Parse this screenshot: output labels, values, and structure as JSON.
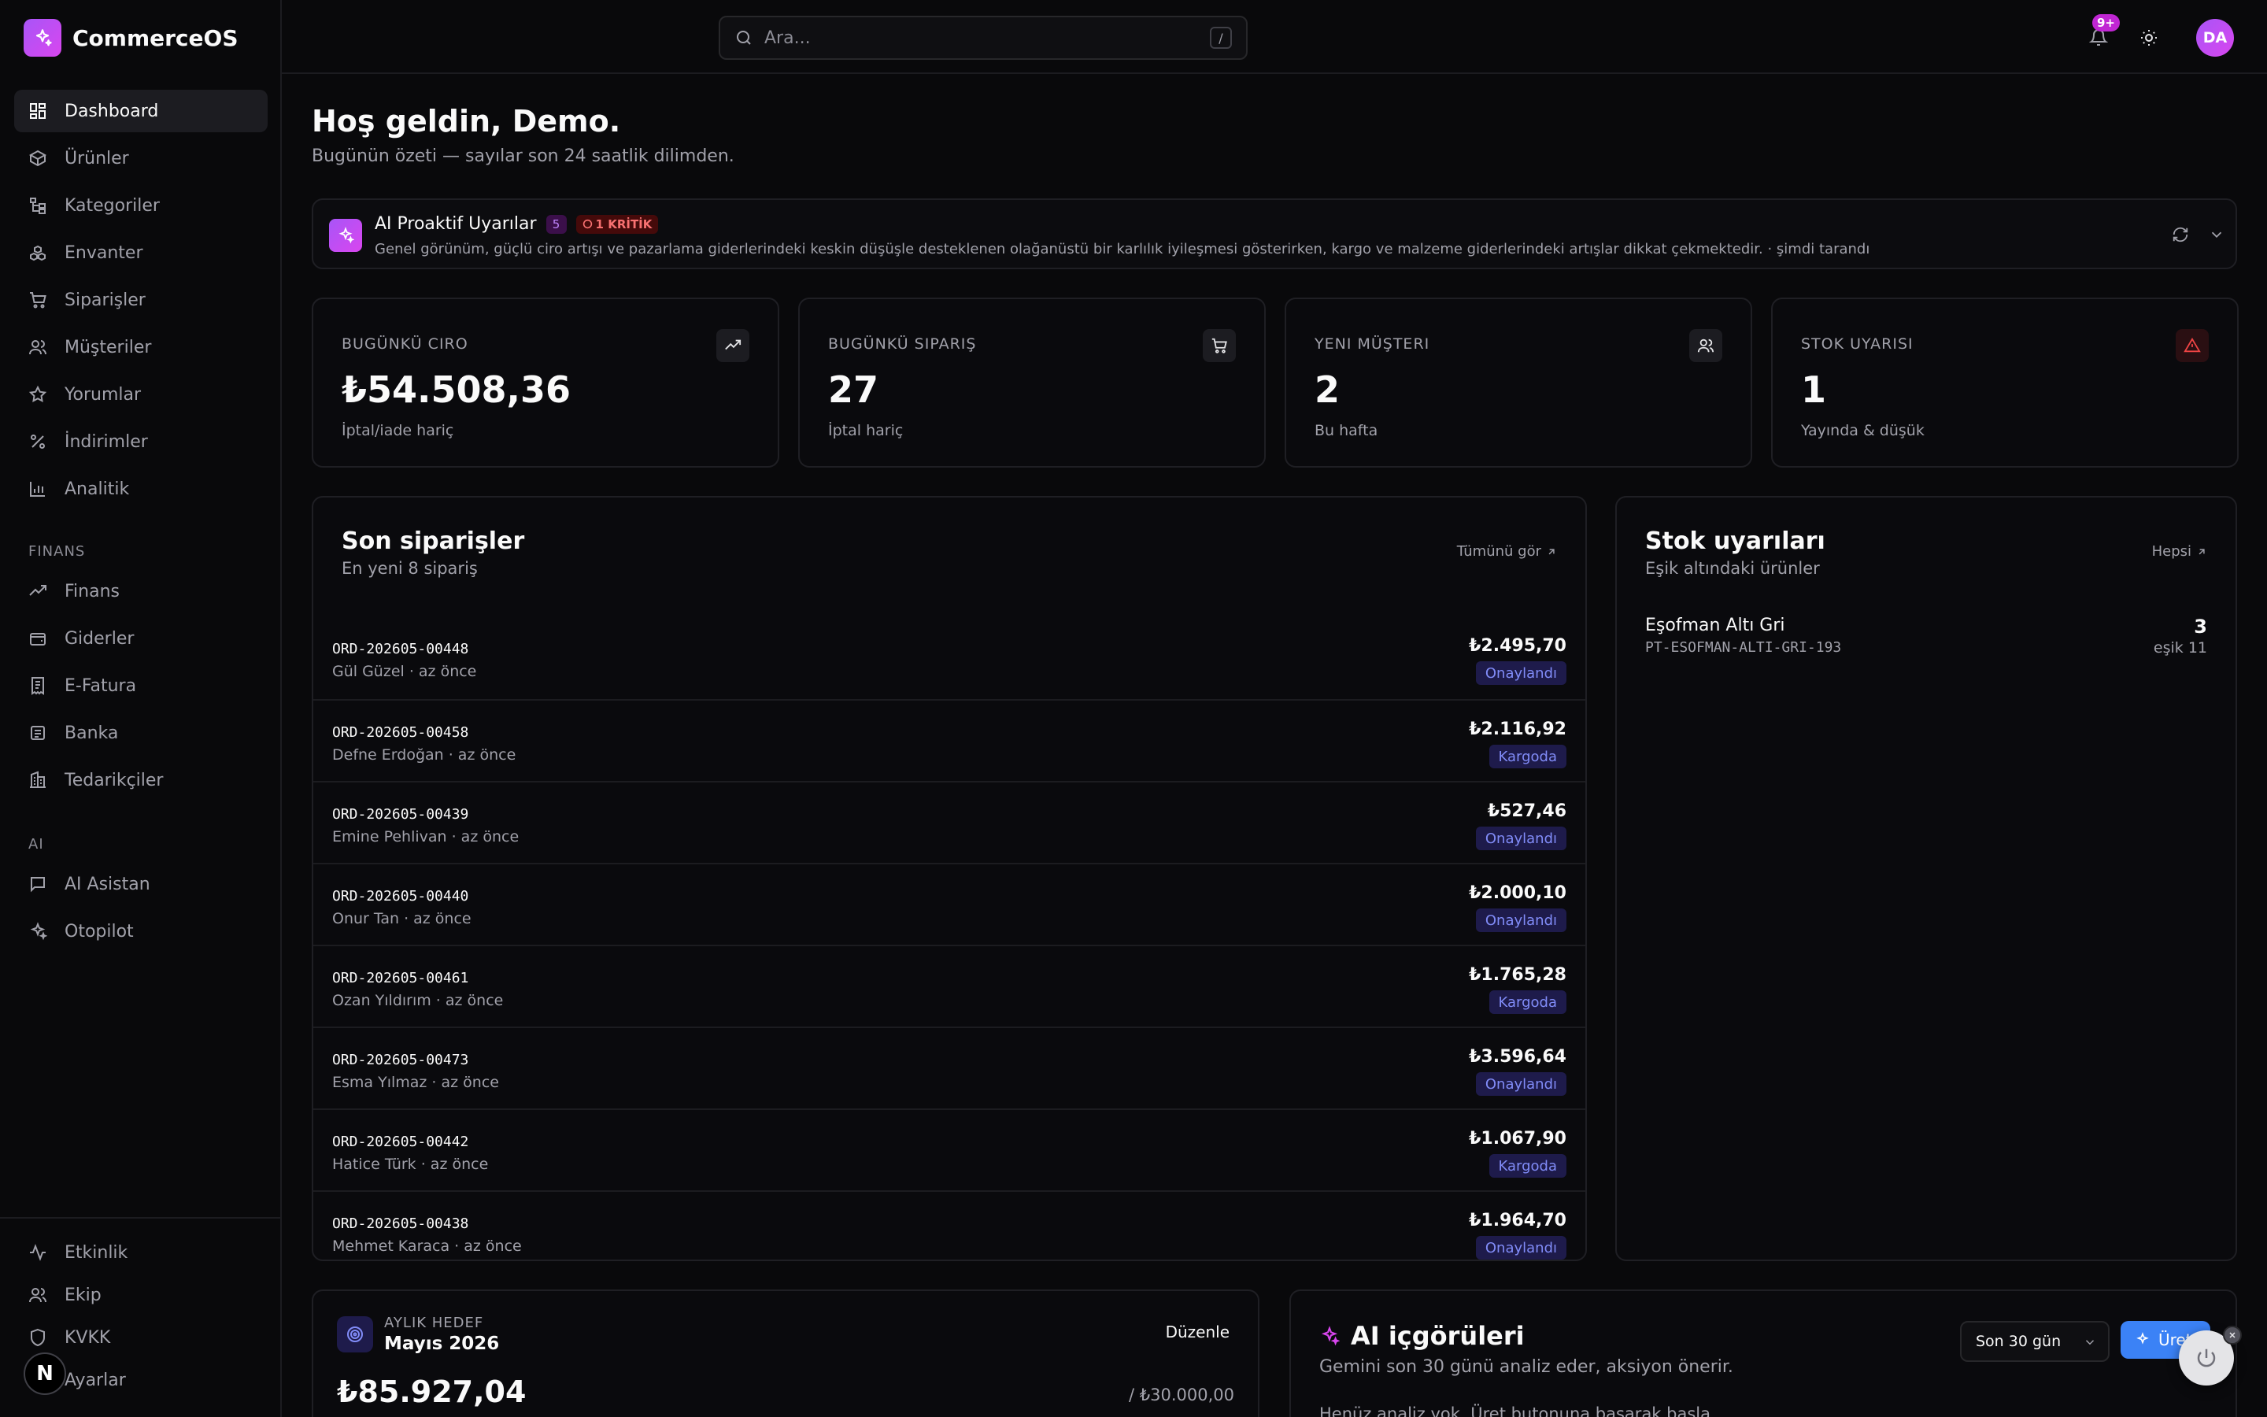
{
  "brand": {
    "name": "CommerceOS"
  },
  "sidebar": {
    "main_items": [
      {
        "label": "Dashboard",
        "icon": "dashboard-icon"
      },
      {
        "label": "Ürünler",
        "icon": "box-icon"
      },
      {
        "label": "Kategoriler",
        "icon": "tree-icon"
      },
      {
        "label": "Envanter",
        "icon": "boxes-icon"
      },
      {
        "label": "Siparişler",
        "icon": "cart-icon"
      },
      {
        "label": "Müşteriler",
        "icon": "users-icon"
      },
      {
        "label": "Yorumlar",
        "icon": "star-icon"
      },
      {
        "label": "İndirimler",
        "icon": "percent-icon"
      },
      {
        "label": "Analitik",
        "icon": "bar-chart-icon"
      }
    ],
    "finance_section": "FINANS",
    "finance_items": [
      {
        "label": "Finans",
        "icon": "trend-icon"
      },
      {
        "label": "Giderler",
        "icon": "wallet-icon"
      },
      {
        "label": "E-Fatura",
        "icon": "receipt-icon"
      },
      {
        "label": "Banka",
        "icon": "bank-icon"
      },
      {
        "label": "Tedarikçiler",
        "icon": "building-icon"
      }
    ],
    "ai_section": "AI",
    "ai_items": [
      {
        "label": "AI Asistan",
        "icon": "chat-icon"
      },
      {
        "label": "Otopilot",
        "icon": "sparkles-icon"
      }
    ],
    "bottom_items": [
      {
        "label": "Etkinlik",
        "icon": "activity-icon"
      },
      {
        "label": "Ekip",
        "icon": "team-icon"
      },
      {
        "label": "KVKK",
        "icon": "shield-icon"
      },
      {
        "label": "Ayarlar",
        "icon": "settings-icon"
      }
    ],
    "badge_letter": "N"
  },
  "topbar": {
    "search_placeholder": "Ara...",
    "search_shortcut": "/",
    "notifications_badge": "9+",
    "avatar_initials": "DA"
  },
  "page": {
    "title": "Hoş geldin, Demo.",
    "subtitle": "Bugünün özeti — sayılar son 24 saatlik dilimden."
  },
  "ai_alerts": {
    "title": "AI Proaktif Uyarılar",
    "count": "5",
    "critical": "1 KRİTİK",
    "description": "Genel görünüm, güçlü ciro artışı ve pazarlama giderlerindeki keskin düşüşle desteklenen olağanüstü bir karlılık iyileşmesi gösterirken, kargo ve malzeme giderlerindeki artışlar dikkat çekmektedir. · şimdi tarandı"
  },
  "kpis": [
    {
      "label": "BUGÜNKÜ CIRO",
      "value": "₺54.508,36",
      "sub": "İptal/iade hariç",
      "icon": "trending-up-icon"
    },
    {
      "label": "BUGÜNKÜ SIPARIŞ",
      "value": "27",
      "sub": "İptal hariç",
      "icon": "cart-icon"
    },
    {
      "label": "YENI MÜŞTERI",
      "value": "2",
      "sub": "Bu hafta",
      "icon": "users-icon"
    },
    {
      "label": "STOK UYARISI",
      "value": "1",
      "sub": "Yayında & düşük",
      "icon": "alert-triangle-icon"
    }
  ],
  "recent_orders": {
    "title": "Son siparişler",
    "subtitle": "En yeni 8 sipariş",
    "link": "Tümünü gör",
    "rows": [
      {
        "id": "ORD-202605-00448",
        "meta": "Gül Güzel · az önce",
        "amount": "₺2.495,70",
        "status": "Onaylandı"
      },
      {
        "id": "ORD-202605-00458",
        "meta": "Defne Erdoğan · az önce",
        "amount": "₺2.116,92",
        "status": "Kargoda"
      },
      {
        "id": "ORD-202605-00439",
        "meta": "Emine Pehlivan · az önce",
        "amount": "₺527,46",
        "status": "Onaylandı"
      },
      {
        "id": "ORD-202605-00440",
        "meta": "Onur Tan · az önce",
        "amount": "₺2.000,10",
        "status": "Onaylandı"
      },
      {
        "id": "ORD-202605-00461",
        "meta": "Ozan Yıldırım · az önce",
        "amount": "₺1.765,28",
        "status": "Kargoda"
      },
      {
        "id": "ORD-202605-00473",
        "meta": "Esma Yılmaz · az önce",
        "amount": "₺3.596,64",
        "status": "Onaylandı"
      },
      {
        "id": "ORD-202605-00442",
        "meta": "Hatice Türk · az önce",
        "amount": "₺1.067,90",
        "status": "Kargoda"
      },
      {
        "id": "ORD-202605-00438",
        "meta": "Mehmet Karaca · az önce",
        "amount": "₺1.964,70",
        "status": "Onaylandı"
      }
    ]
  },
  "stock_alerts": {
    "title": "Stok uyarıları",
    "subtitle": "Eşik altındaki ürünler",
    "link": "Hepsi",
    "items": [
      {
        "name": "Eşofman Altı Gri",
        "sku": "PT-ESOFMAN-ALTI-GRI-193",
        "qty": "3",
        "threshold": "eşik 11"
      }
    ]
  },
  "monthly_goal": {
    "label": "AYLIK HEDEF",
    "period": "Mayıs 2026",
    "edit": "Düzenle",
    "value": "₺85.927,04",
    "target": "/ ₺30.000,00"
  },
  "ai_insights": {
    "title": "AI içgörüleri",
    "subtitle": "Gemini son 30 günü analiz eder, aksiyon önerir.",
    "empty_text": "Henüz analiz yok. Üret butonuna basarak başla.",
    "period_select": "Son 30 gün",
    "generate_button": "Üret"
  }
}
